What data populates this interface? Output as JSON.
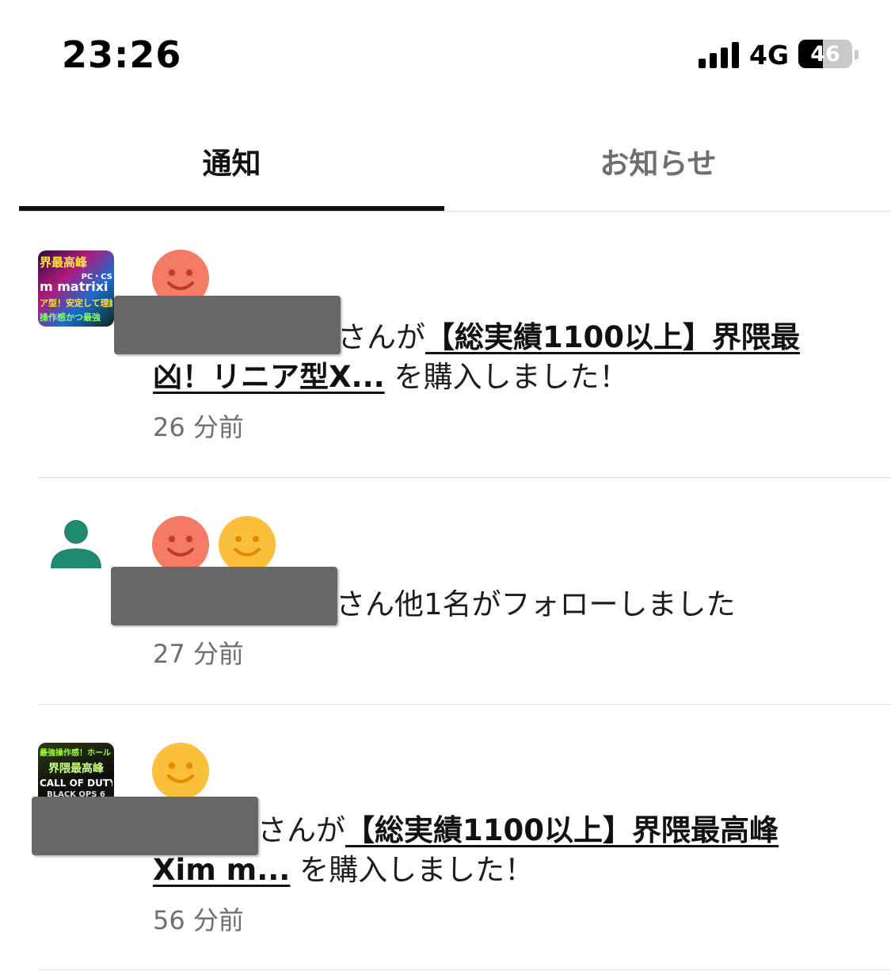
{
  "status_bar": {
    "time": "23:26",
    "network": "4G",
    "battery": "46",
    "battery_level": 0.46
  },
  "tabs": [
    {
      "label": "通知",
      "active": true
    },
    {
      "label": "お知らせ",
      "active": false
    }
  ],
  "notifications": [
    {
      "thumb_lines": [
        "界最高峰",
        "PC・CS",
        "m matrixi",
        "ア型！安定して理論",
        "操作感かつ最強"
      ],
      "faces": [
        "red"
      ],
      "pre_text": "さんが",
      "link_line1": "【総実績1100以上】界隈最",
      "link_line2": "凶！リニア型X...",
      "post_text": " を購入しました！",
      "time_ago": "26 分前"
    },
    {
      "icon": "person-icon",
      "faces": [
        "red",
        "yellow"
      ],
      "text": "さん他1名がフォローしました",
      "time_ago": "27 分前"
    },
    {
      "thumb_lines": [
        "最強操作感！ホールド",
        "界隈最高峰",
        "CALL OF DUTY",
        "BLACK OPS 6"
      ],
      "faces": [
        "yellow"
      ],
      "pre_text": "さんが",
      "link_line1": "【総実績1100以上】界隈最高峰",
      "link_line2": "Xim m...",
      "post_text": " を購入しました！",
      "time_ago": "56 分前"
    }
  ],
  "colors": {
    "face_red": "#f47c67",
    "face_yellow": "#fcbf3c",
    "person_icon": "#1f8a70",
    "redaction": "#68686a"
  }
}
